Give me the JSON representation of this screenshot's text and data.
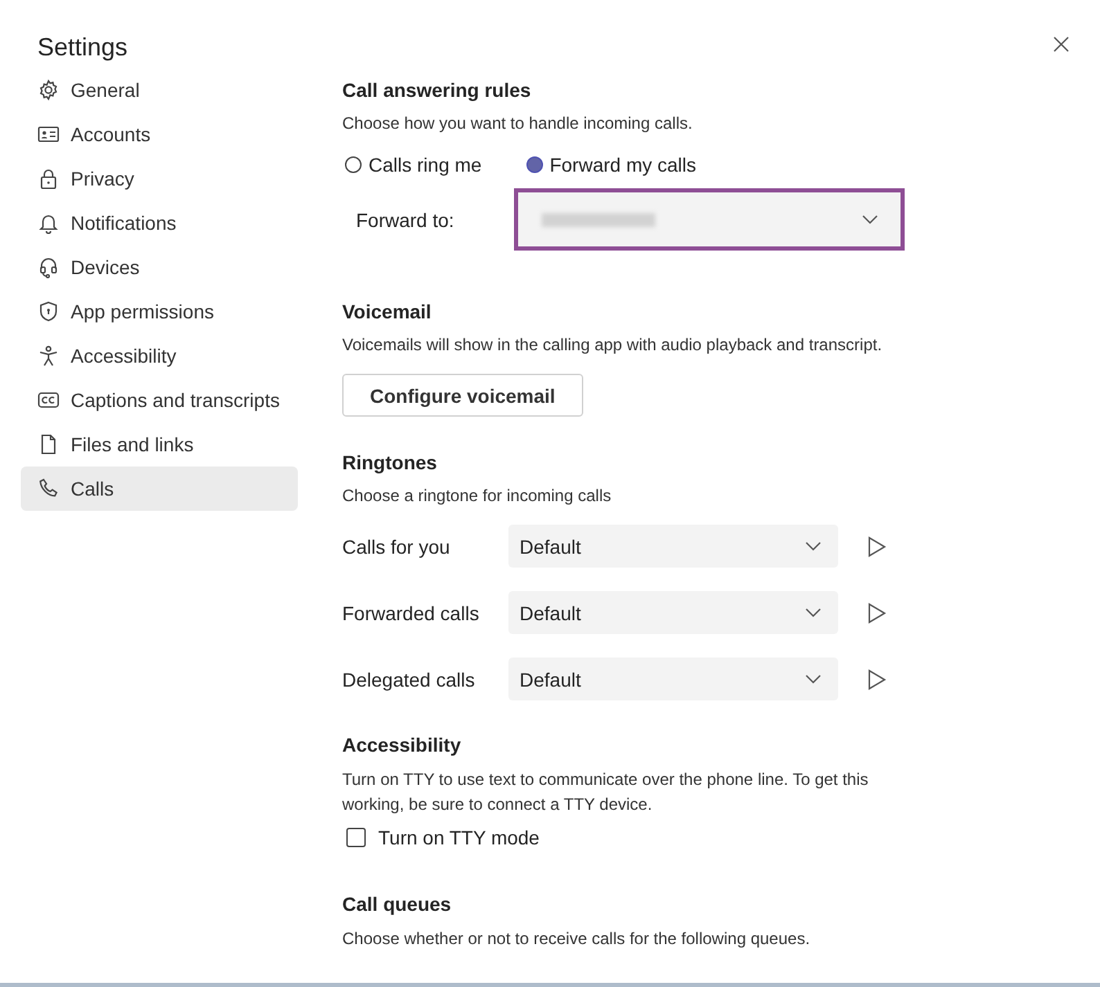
{
  "window": {
    "title": "Settings"
  },
  "sidebar": {
    "items": [
      {
        "label": "General",
        "selected": false
      },
      {
        "label": "Accounts",
        "selected": false
      },
      {
        "label": "Privacy",
        "selected": false
      },
      {
        "label": "Notifications",
        "selected": false
      },
      {
        "label": "Devices",
        "selected": false
      },
      {
        "label": "App permissions",
        "selected": false
      },
      {
        "label": "Accessibility",
        "selected": false
      },
      {
        "label": "Captions and transcripts",
        "selected": false
      },
      {
        "label": "Files and links",
        "selected": false
      },
      {
        "label": "Calls",
        "selected": true
      }
    ]
  },
  "call_answering": {
    "heading": "Call answering rules",
    "description": "Choose how you want to handle incoming calls.",
    "options": [
      {
        "label": "Calls ring me",
        "selected": false
      },
      {
        "label": "Forward my calls",
        "selected": true
      }
    ],
    "forward_to": {
      "label": "Forward to:",
      "focused": true
    }
  },
  "voicemail": {
    "heading": "Voicemail",
    "description": "Voicemails will show in the calling app with audio playback and transcript.",
    "button": "Configure voicemail"
  },
  "ringtones": {
    "heading": "Ringtones",
    "description": "Choose a ringtone for incoming calls",
    "rows": [
      {
        "label": "Calls for you",
        "value": "Default"
      },
      {
        "label": "Forwarded calls",
        "value": "Default"
      },
      {
        "label": "Delegated calls",
        "value": "Default"
      }
    ]
  },
  "accessibility": {
    "heading": "Accessibility",
    "description": "Turn on TTY to use text to communicate over the phone line. To get this working, be sure to connect a TTY device.",
    "checkbox": {
      "label": "Turn on TTY mode",
      "checked": false
    }
  },
  "call_queues": {
    "heading": "Call queues",
    "description": "Choose whether or not to receive calls for the following queues."
  }
}
